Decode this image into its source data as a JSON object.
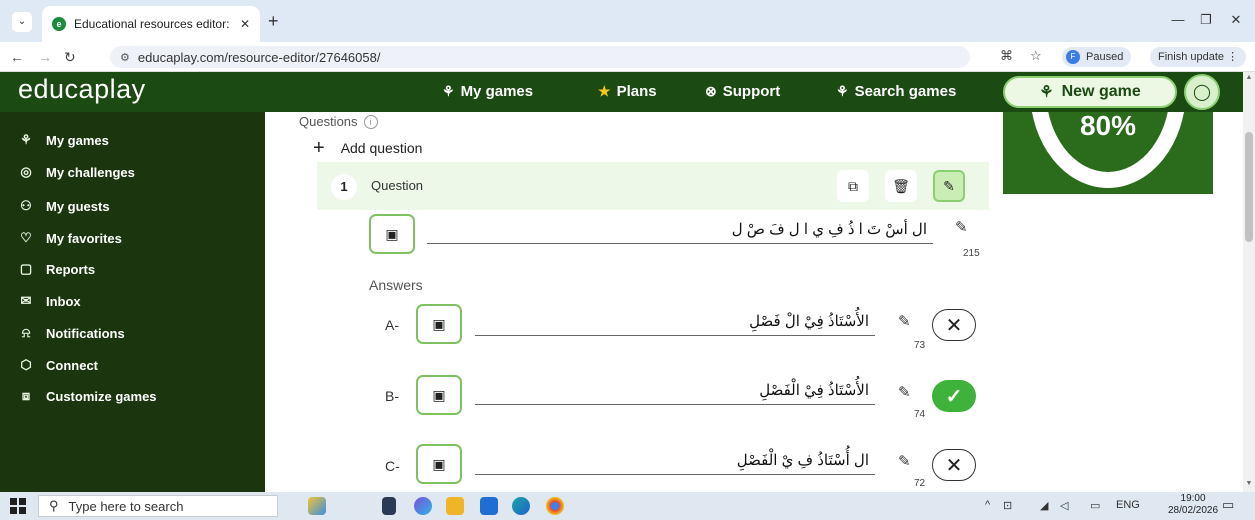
{
  "browser": {
    "tab_title": "Educational resources editor: Pc",
    "tab_favicon": "e",
    "url": "educaplay.com/resource-editor/27646058/",
    "profile_initial": "F",
    "profile_status": "Paused",
    "finish_update": "Finish update"
  },
  "header": {
    "logo": "educaplay",
    "nav": [
      {
        "label": "My games",
        "icon": "puzzle-icon"
      },
      {
        "label": "Plans",
        "icon": "star-icon"
      },
      {
        "label": "Support",
        "icon": "lifebuoy-icon"
      },
      {
        "label": "Search games",
        "icon": "search-puzzle-icon"
      }
    ],
    "new_game": "New game"
  },
  "sidebar": {
    "items": [
      {
        "label": "My games",
        "icon": "puzzle-icon"
      },
      {
        "label": "My challenges",
        "icon": "target-icon"
      },
      {
        "label": "My guests",
        "icon": "guests-icon"
      },
      {
        "label": "My favorites",
        "icon": "heart-icon"
      },
      {
        "label": "Reports",
        "icon": "clipboard-icon"
      },
      {
        "label": "Inbox",
        "icon": "mail-icon"
      },
      {
        "label": "Notifications",
        "icon": "bell-icon"
      },
      {
        "label": "Connect",
        "icon": "box-icon"
      },
      {
        "label": "Customize games",
        "icon": "layers-icon"
      }
    ]
  },
  "editor": {
    "questions_label": "Questions",
    "add_question": "Add question",
    "question": {
      "number": "1",
      "title": "Question",
      "text": "ال أسْ تَ ا ذُ فِ ي ا ل فَ صْ ل",
      "counter": "215"
    },
    "answers_label": "Answers",
    "answers": [
      {
        "letter": "A-",
        "text": "الأُسْتَاذُ فِيْ الْ فَصْلِ",
        "counter": "73",
        "correct": false
      },
      {
        "letter": "B-",
        "text": "الأُسْتَاذُ فِيْ الْفَصْلِ",
        "counter": "74",
        "correct": true
      },
      {
        "letter": "C-",
        "text": "ال أُسْتَاذُ فِ يْ الْفَصْلِ",
        "counter": "72",
        "correct": false
      }
    ]
  },
  "progress": {
    "percent_label": "80%",
    "value": 0.8
  },
  "taskbar": {
    "search_placeholder": "Type here to search",
    "lang": "ENG",
    "time": "19:00",
    "date": "28/02/2026"
  },
  "colors": {
    "header_green": "#1b4a12",
    "sidebar_green": "#1b360f",
    "accent_green": "#8ccf73",
    "correct_green": "#3fb23b"
  }
}
